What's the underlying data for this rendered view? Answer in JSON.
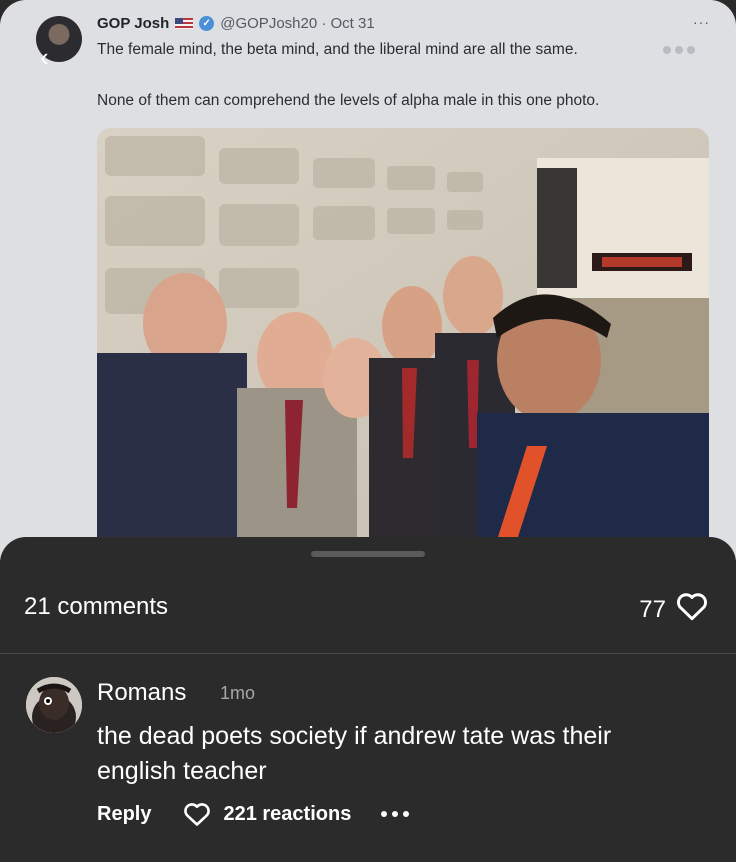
{
  "tweet": {
    "author_name": "GOP Josh",
    "handle_date": "@GOPJosh20 · Oct 31",
    "more_glyph": "···",
    "line1": "The female mind, the beta mind, and the liberal mind are all the same.",
    "line2": "None of them can comprehend the levels of alpha male in this one photo.",
    "back_glyph": "‹"
  },
  "sheet": {
    "comments_label": "21 comments",
    "likes_count": "77"
  },
  "comment": {
    "author": "Romans",
    "time": "1mo",
    "text": "the dead poets society if andrew tate was their english teacher",
    "reply_label": "Reply",
    "reactions_label": "221 reactions"
  },
  "colors": {
    "sheet_bg": "#2b2b2c",
    "tweet_bg": "#dedfe3",
    "verified": "#4a90d9"
  }
}
